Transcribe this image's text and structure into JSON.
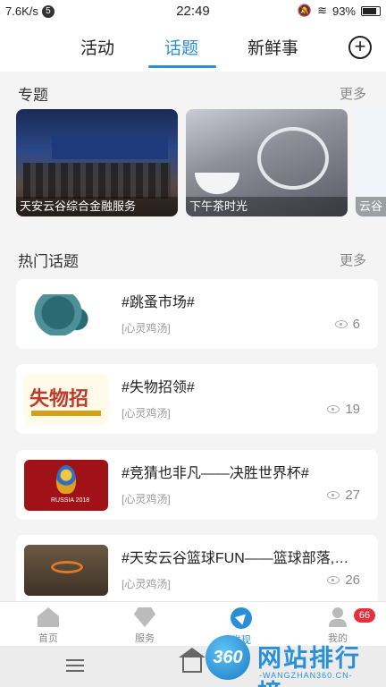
{
  "status_bar": {
    "speed": "7.6K/s",
    "sim": "5",
    "time": "22:49",
    "battery": "93%"
  },
  "tabs": [
    {
      "label": "活动",
      "active": false
    },
    {
      "label": "话题",
      "active": true
    },
    {
      "label": "新鲜事",
      "active": false
    }
  ],
  "add_button": "+",
  "topics_section": {
    "title": "专题",
    "more": "更多",
    "cards": [
      {
        "caption": "天安云谷综合金融服务"
      },
      {
        "caption": "下午茶时光"
      },
      {
        "caption": "云谷"
      }
    ]
  },
  "hot_section": {
    "title": "热门话题",
    "more": "更多",
    "items": [
      {
        "title": "#跳蚤市场#",
        "tag": "[心灵鸡汤]",
        "views": "6"
      },
      {
        "title": "#失物招领#",
        "tag": "[心灵鸡汤]",
        "views": "19"
      },
      {
        "title": "#竞猜也非凡——决胜世界杯#",
        "tag": "[心灵鸡汤]",
        "views": "27"
      },
      {
        "title": "#天安云谷篮球FUN——篮球部落,…",
        "tag": "[心灵鸡汤]",
        "views": "26"
      }
    ]
  },
  "thumb_text": {
    "lost_found": "失物招",
    "world_cup": "RUSSIA 2018"
  },
  "bottom_nav": [
    {
      "label": "首页",
      "icon": "home-icon"
    },
    {
      "label": "服务",
      "icon": "service-icon"
    },
    {
      "label": "发现",
      "icon": "discover-icon",
      "active": true
    },
    {
      "label": "我的",
      "icon": "profile-icon"
    }
  ],
  "badge": "66",
  "watermark": {
    "logo": "360",
    "text": "网站排行榜",
    "sub": "-WANGZHAN360.CN-"
  },
  "colors": {
    "accent": "#2a8fd6",
    "badge": "#e8303a"
  }
}
